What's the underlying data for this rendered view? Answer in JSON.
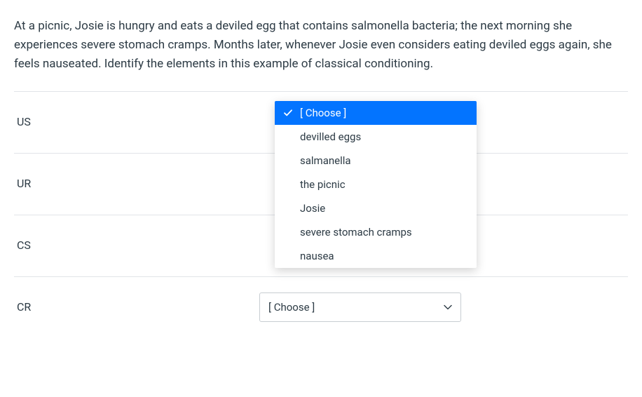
{
  "question": "At a picnic, Josie is hungry and eats a deviled egg that contains salmonella bacteria; the next morning she experiences severe stomach cramps. Months later, whenever Josie even considers eating deviled eggs again, she feels nauseated.  Identify the elements in this example of classical conditioning.",
  "rows": [
    {
      "label": "US",
      "selected": "[ Choose ]",
      "open": true
    },
    {
      "label": "UR",
      "selected": "[ Choose ]",
      "open": false
    },
    {
      "label": "CS",
      "selected": "[ Choose ]",
      "open": false
    },
    {
      "label": "CR",
      "selected": "[ Choose ]",
      "open": false
    }
  ],
  "options": [
    "[ Choose ]",
    "devilled eggs",
    "salmanella",
    "the picnic",
    "Josie",
    "severe stomach cramps",
    "nausea"
  ],
  "placeholder": "[ Choose ]",
  "colors": {
    "highlight": "#0374ff",
    "text": "#2d3b45",
    "border": "#e1e4e8"
  }
}
